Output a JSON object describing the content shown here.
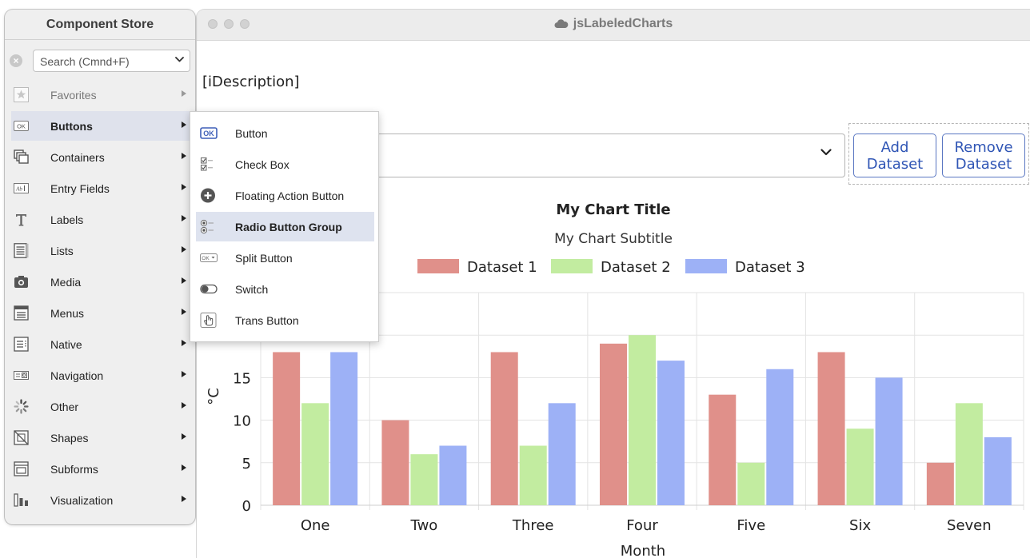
{
  "window": {
    "title": "jsLabeledCharts",
    "description_placeholder": "[iDescription]"
  },
  "dataset_select": {
    "value": ""
  },
  "actions": {
    "add_line1": "Add",
    "add_line2": "Dataset",
    "remove_line1": "Remove",
    "remove_line2": "Dataset"
  },
  "component_store": {
    "title": "Component Store",
    "search_placeholder": "Search (Cmnd+F)",
    "categories": [
      {
        "label": "Favorites",
        "icon": "star-icon"
      },
      {
        "label": "Buttons",
        "icon": "ok-button-icon"
      },
      {
        "label": "Containers",
        "icon": "containers-icon"
      },
      {
        "label": "Entry Fields",
        "icon": "entry-field-icon"
      },
      {
        "label": "Labels",
        "icon": "text-label-icon"
      },
      {
        "label": "Lists",
        "icon": "list-icon"
      },
      {
        "label": "Media",
        "icon": "camera-icon"
      },
      {
        "label": "Menus",
        "icon": "menu-icon"
      },
      {
        "label": "Native",
        "icon": "native-icon"
      },
      {
        "label": "Navigation",
        "icon": "navigation-icon"
      },
      {
        "label": "Other",
        "icon": "spinner-icon"
      },
      {
        "label": "Shapes",
        "icon": "shapes-icon"
      },
      {
        "label": "Subforms",
        "icon": "subform-icon"
      },
      {
        "label": "Visualization",
        "icon": "bar-chart-icon"
      }
    ],
    "selected_category": "Buttons"
  },
  "submenu": {
    "items": [
      {
        "label": "Button",
        "icon": "ok-button-icon"
      },
      {
        "label": "Check Box",
        "icon": "checkbox-icon"
      },
      {
        "label": "Floating Action Button",
        "icon": "plus-circle-icon"
      },
      {
        "label": "Radio Button Group",
        "icon": "radio-group-icon"
      },
      {
        "label": "Split Button",
        "icon": "split-button-icon"
      },
      {
        "label": "Switch",
        "icon": "toggle-icon"
      },
      {
        "label": "Trans Button",
        "icon": "pointer-hand-icon"
      }
    ],
    "highlighted": "Radio Button Group"
  },
  "colors": {
    "dataset1": "#e0908a",
    "dataset2": "#c2eca0",
    "dataset3": "#9db1f6",
    "accent": "#2f55b5"
  },
  "chart_data": {
    "type": "bar",
    "title": "My Chart Title",
    "subtitle": "My Chart Subtitle",
    "xlabel": "Month",
    "ylabel": "°C",
    "categories": [
      "One",
      "Two",
      "Three",
      "Four",
      "Five",
      "Six",
      "Seven"
    ],
    "series": [
      {
        "name": "Dataset 1",
        "values": [
          18,
          10,
          18,
          19,
          13,
          18,
          5
        ]
      },
      {
        "name": "Dataset 2",
        "values": [
          12,
          6,
          7,
          20,
          5,
          9,
          12
        ]
      },
      {
        "name": "Dataset 3",
        "values": [
          18,
          7,
          12,
          17,
          16,
          15,
          8
        ]
      }
    ],
    "y_ticks": [
      "0",
      "5",
      "10",
      "15"
    ],
    "ylim": [
      0,
      25
    ],
    "grid": true,
    "legend_position": "top"
  }
}
